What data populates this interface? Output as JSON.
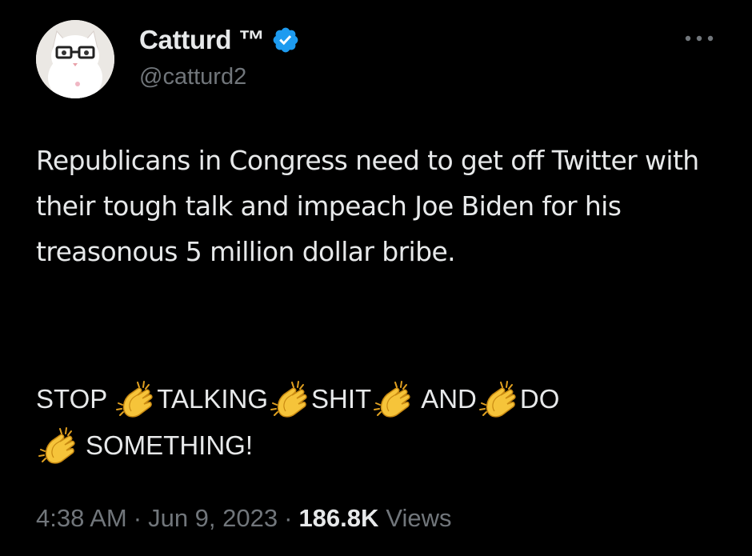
{
  "author": {
    "display_name": "Catturd ™",
    "handle": "@catturd2",
    "verified_color": "#1d9bf0"
  },
  "icons": {
    "more": "more-horizontal-icon",
    "verified": "verified-badge-icon",
    "emoji": "clapping-hands-icon"
  },
  "tweet": {
    "text": "Republicans in Congress need to get off Twitter with their tough talk and impeach Joe Biden for his treasonous 5 million dollar bribe.",
    "shout_words": [
      "STOP",
      "TALKING",
      "SHIT",
      "AND",
      "DO",
      "SOMETHING!"
    ]
  },
  "meta": {
    "time": "4:38 AM",
    "date": "Jun 9, 2023",
    "separator": "·",
    "views_count": "186.8K",
    "views_label": "Views"
  },
  "colors": {
    "background": "#000000",
    "text": "#e7e9ea",
    "secondary": "#71767b",
    "accent": "#1d9bf0"
  }
}
